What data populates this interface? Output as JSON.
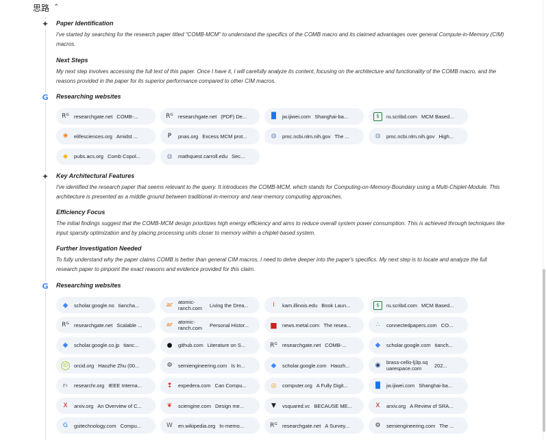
{
  "header": {
    "title": "思路",
    "toggle_icon": "chevron-up-icon"
  },
  "sections": [
    {
      "icon": "sparkle-icon",
      "title": "Paper Identification",
      "text": "I've started by searching for the research paper titled \"COMB-MCM\" to understand the specifics of the COMB macro and its claimed advantages over general Compute-in-Memory (CIM) macros."
    },
    {
      "icon": "",
      "title": "Next Steps",
      "text": "My next step involves accessing the full text of this paper. Once I have it, I will carefully analyze its content, focusing on the architecture and functionality of the COMB macro, and the reasons provided in the paper for its superior performance compared to other CIM macros."
    },
    {
      "icon": "sparkle-icon",
      "title": "Key Architectural Features",
      "text": "I've identified the research paper that seems relevant to the query. It introduces the COMB-MCM, which stands for Computing-on-Memory-Boundary using a Multi-Chiplet-Module. This architecture is presented as a middle ground between traditional in-memory and near-memory computing approaches."
    },
    {
      "icon": "",
      "title": "Efficiency Focus",
      "text": "The initial findings suggest that the COMB-MCM design prioritizes high energy efficiency and aims to reduce overall system power consumption. This is achieved through techniques like input sparsity optimization and by placing processing units closer to memory within a chiplet-based system."
    },
    {
      "icon": "",
      "title": "Further Investigation Needed",
      "text": "To fully understand why the paper claims COMB is better than general CIM macros, I need to delve deeper into the paper's specifics. My next step is to locate and analyze the full research paper to pinpoint the exact reasons and evidence provided for this claim."
    }
  ],
  "research_groups": [
    {
      "title": "Researching websites",
      "icon": "google-icon",
      "chips": [
        {
          "domain": "researchgate.net",
          "title": "COMB-...",
          "icon": "researchgate-icon",
          "icon_color": "#333333"
        },
        {
          "domain": "researchgate.net",
          "title": "(PDF) De...",
          "icon": "researchgate-icon",
          "icon_color": "#333333"
        },
        {
          "domain": "jw.ijiwei.com",
          "title": "Shanghai-ba...",
          "icon": "bar-chart-icon",
          "icon_color": "#1a73e8"
        },
        {
          "domain": "ru.scribd.com",
          "title": "MCM Based...",
          "icon": "scribd-icon",
          "icon_color": "#1e7e34"
        },
        {
          "domain": "elifesciences.org",
          "title": "Amidst ...",
          "icon": "elife-icon",
          "icon_color": "#e8710a"
        },
        {
          "domain": "pnas.org",
          "title": "Excess MCM prot...",
          "icon": "pnas-icon",
          "icon_color": "#111111"
        },
        {
          "domain": "pmc.ncbi.nlm.nih.gov",
          "title": "The ...",
          "icon": "globe-icon",
          "icon_color": "#7b8fb0"
        },
        {
          "domain": "pmc.ncbi.nlm.nih.gov",
          "title": "High...",
          "icon": "globe-icon",
          "icon_color": "#7b8fb0"
        },
        {
          "domain": "pubs.acs.org",
          "title": "Comb Copol...",
          "icon": "acs-icon",
          "icon_color": "#f2b705"
        },
        {
          "domain": "mathquest.carroll.edu",
          "title": "Sec...",
          "icon": "globe-icon",
          "icon_color": "#7b8fb0"
        }
      ]
    },
    {
      "title": "Researching websites",
      "icon": "google-icon",
      "chips": [
        {
          "domain": "scholar.google.no",
          "title": "tiancha...",
          "icon": "scholar-icon",
          "icon_color": "#4285f4"
        },
        {
          "domain": "atomic-ranch.com",
          "title": "Living the Drea...",
          "icon": "atomic-ranch-icon",
          "icon_color": "#e8710a"
        },
        {
          "domain": "kam.illinois.edu",
          "title": "Book Laun...",
          "icon": "illinois-icon",
          "icon_color": "#e8472b"
        },
        {
          "domain": "ru.scribd.com",
          "title": "MCM Based...",
          "icon": "scribd-icon",
          "icon_color": "#1e7e34"
        },
        {
          "domain": "researchgate.net",
          "title": "Scalable ...",
          "icon": "researchgate-icon",
          "icon_color": "#333333"
        },
        {
          "domain": "atomic-ranch.com",
          "title": "Personal Histor...",
          "icon": "atomic-ranch-icon",
          "icon_color": "#e8710a"
        },
        {
          "domain": "news.metal.com",
          "title": "The resea...",
          "icon": "smm-icon",
          "icon_color": "#c5221f"
        },
        {
          "domain": "connectedpapers.com",
          "title": "CO...",
          "icon": "connected-papers-icon",
          "icon_color": "#2e9bb3"
        },
        {
          "domain": "scholar.google.co.jp",
          "title": "tianc...",
          "icon": "scholar-icon",
          "icon_color": "#4285f4"
        },
        {
          "domain": "github.com",
          "title": "Literature on S...",
          "icon": "github-icon",
          "icon_color": "#111111"
        },
        {
          "domain": "researchgate.net",
          "title": "COMB-...",
          "icon": "researchgate-icon",
          "icon_color": "#333333"
        },
        {
          "domain": "scholar.google.com",
          "title": "tianch...",
          "icon": "scholar-icon",
          "icon_color": "#4285f4"
        },
        {
          "domain": "orcid.org",
          "title": "Haozhe Zhu (00...",
          "icon": "orcid-icon",
          "icon_color": "#a6ce39"
        },
        {
          "domain": "semiengineering.com",
          "title": "Is In...",
          "icon": "semi-icon",
          "icon_color": "#333333"
        },
        {
          "domain": "scholar.google.com",
          "title": "Haozh...",
          "icon": "scholar-icon",
          "icon_color": "#4285f4"
        },
        {
          "domain": "brass-cello-lj3p.squarespace.com",
          "title": "202...",
          "icon": "squarespace-icon",
          "icon_color": "#1a3c6e"
        },
        {
          "domain": "researchr.org",
          "title": "IEEE Interna...",
          "icon": "researchr-icon",
          "icon_color": "#555555"
        },
        {
          "domain": "expedera.com",
          "title": "Can Compu...",
          "icon": "expedera-icon",
          "icon_color": "#d93025"
        },
        {
          "domain": "computer.org",
          "title": "A Fully Digit...",
          "icon": "computer-org-icon",
          "icon_color": "#f29900"
        },
        {
          "domain": "jw.ijiwei.com",
          "title": "Shanghai-ba...",
          "icon": "bar-chart-icon",
          "icon_color": "#1a73e8"
        },
        {
          "domain": "arxiv.org",
          "title": "An Overview of C...",
          "icon": "arxiv-icon",
          "icon_color": "#b31b1b"
        },
        {
          "domain": "sciengine.com",
          "title": "Design me...",
          "icon": "sciengine-icon",
          "icon_color": "#d93025"
        },
        {
          "domain": "vsquared.vc",
          "title": "BECAUSE ME...",
          "icon": "vsquared-icon",
          "icon_color": "#222222"
        },
        {
          "domain": "arxiv.org",
          "title": "A Review of SRA...",
          "icon": "arxiv-icon",
          "icon_color": "#b31b1b"
        },
        {
          "domain": "gsitechnology.com",
          "title": "Compu...",
          "icon": "gsi-icon",
          "icon_color": "#1a73e8"
        },
        {
          "domain": "en.wikipedia.org",
          "title": "In-memo...",
          "icon": "wikipedia-icon",
          "icon_color": "#555555"
        },
        {
          "domain": "researchgate.net",
          "title": "A Survey...",
          "icon": "researchgate-icon",
          "icon_color": "#333333"
        },
        {
          "domain": "semiengineering.com",
          "title": "The ...",
          "icon": "semi-icon",
          "icon_color": "#333333"
        }
      ]
    }
  ]
}
